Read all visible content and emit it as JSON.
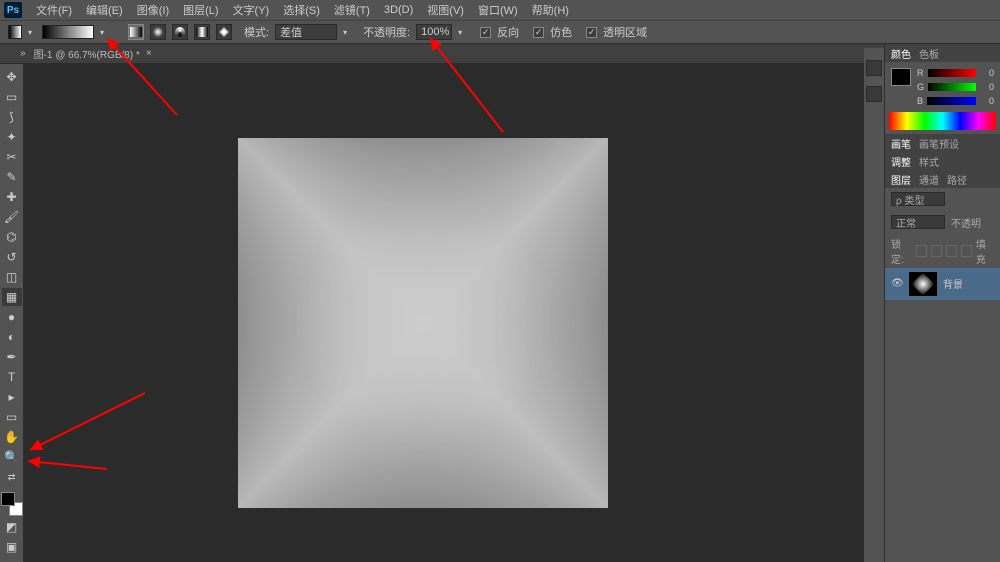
{
  "app_logo": "Ps",
  "menu": [
    "文件(F)",
    "编辑(E)",
    "图像(I)",
    "图层(L)",
    "文字(Y)",
    "选择(S)",
    "滤镜(T)",
    "3D(D)",
    "视图(V)",
    "窗口(W)",
    "帮助(H)"
  ],
  "options": {
    "mode_label": "模式:",
    "mode_value": "差值",
    "opacity_label": "不透明度:",
    "opacity_value": "100%",
    "reverse_label": "反向",
    "dither_label": "仿色",
    "transparency_label": "透明区域"
  },
  "document": {
    "tab_title": "图-1 @ 66.7%(RGB/8) *",
    "close": "×"
  },
  "right": {
    "color_tab": "颜色",
    "swatch_tab": "色板",
    "r_label": "R",
    "r_val": "0",
    "g_label": "G",
    "g_val": "0",
    "b_label": "B",
    "b_val": "0",
    "brush_tab": "画笔",
    "brush_preset_tab": "画笔预设",
    "adjust_tab": "调整",
    "styles_tab": "样式",
    "layers_tab": "图层",
    "channels_tab": "通道",
    "paths_tab": "路径",
    "blend_mode": "正常",
    "opacity_short": "不透明",
    "lock_label": "锁定:",
    "fill_label": "填充",
    "layer_name": "背景"
  }
}
